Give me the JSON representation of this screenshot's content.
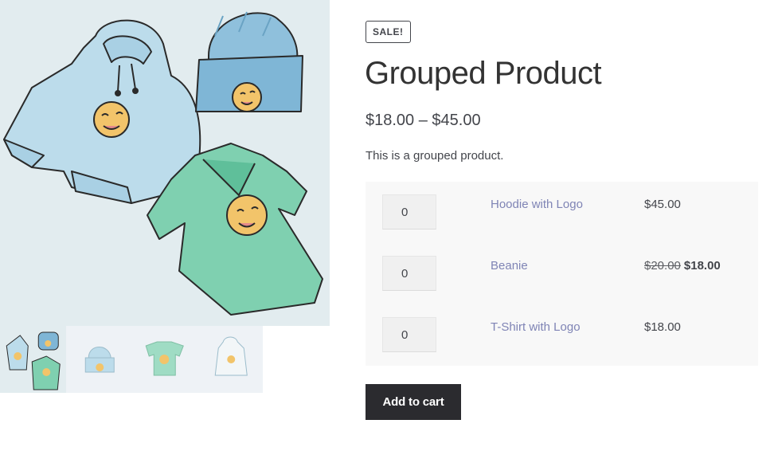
{
  "gallery": {
    "main_image_alt": "Grouped product hoodie, beanie and t-shirt",
    "thumbnails": [
      {
        "name": "thumbnail-grouped"
      },
      {
        "name": "thumbnail-beanie"
      },
      {
        "name": "thumbnail-tshirt"
      },
      {
        "name": "thumbnail-hoodie"
      }
    ]
  },
  "product": {
    "badge": "SALE!",
    "title": "Grouped Product",
    "price_range": "$18.00 – $45.00",
    "description": "This is a grouped product."
  },
  "grouped_items": [
    {
      "qty": "0",
      "name": "Hoodie with Logo",
      "price": "$45.00",
      "old_price": "",
      "sale_price": ""
    },
    {
      "qty": "0",
      "name": "Beanie",
      "price": "",
      "old_price": "$20.00",
      "sale_price": "$18.00"
    },
    {
      "qty": "0",
      "name": "T-Shirt with Logo",
      "price": "$18.00",
      "old_price": "",
      "sale_price": ""
    }
  ],
  "actions": {
    "add_to_cart": "Add to cart"
  },
  "colors": {
    "hoodie": "#bcdceb",
    "beanie": "#7fb6d6",
    "tshirt": "#7fd0b0",
    "emoji": "#f2c46a",
    "link": "#7f84b5",
    "button": "#2b2b2f"
  }
}
